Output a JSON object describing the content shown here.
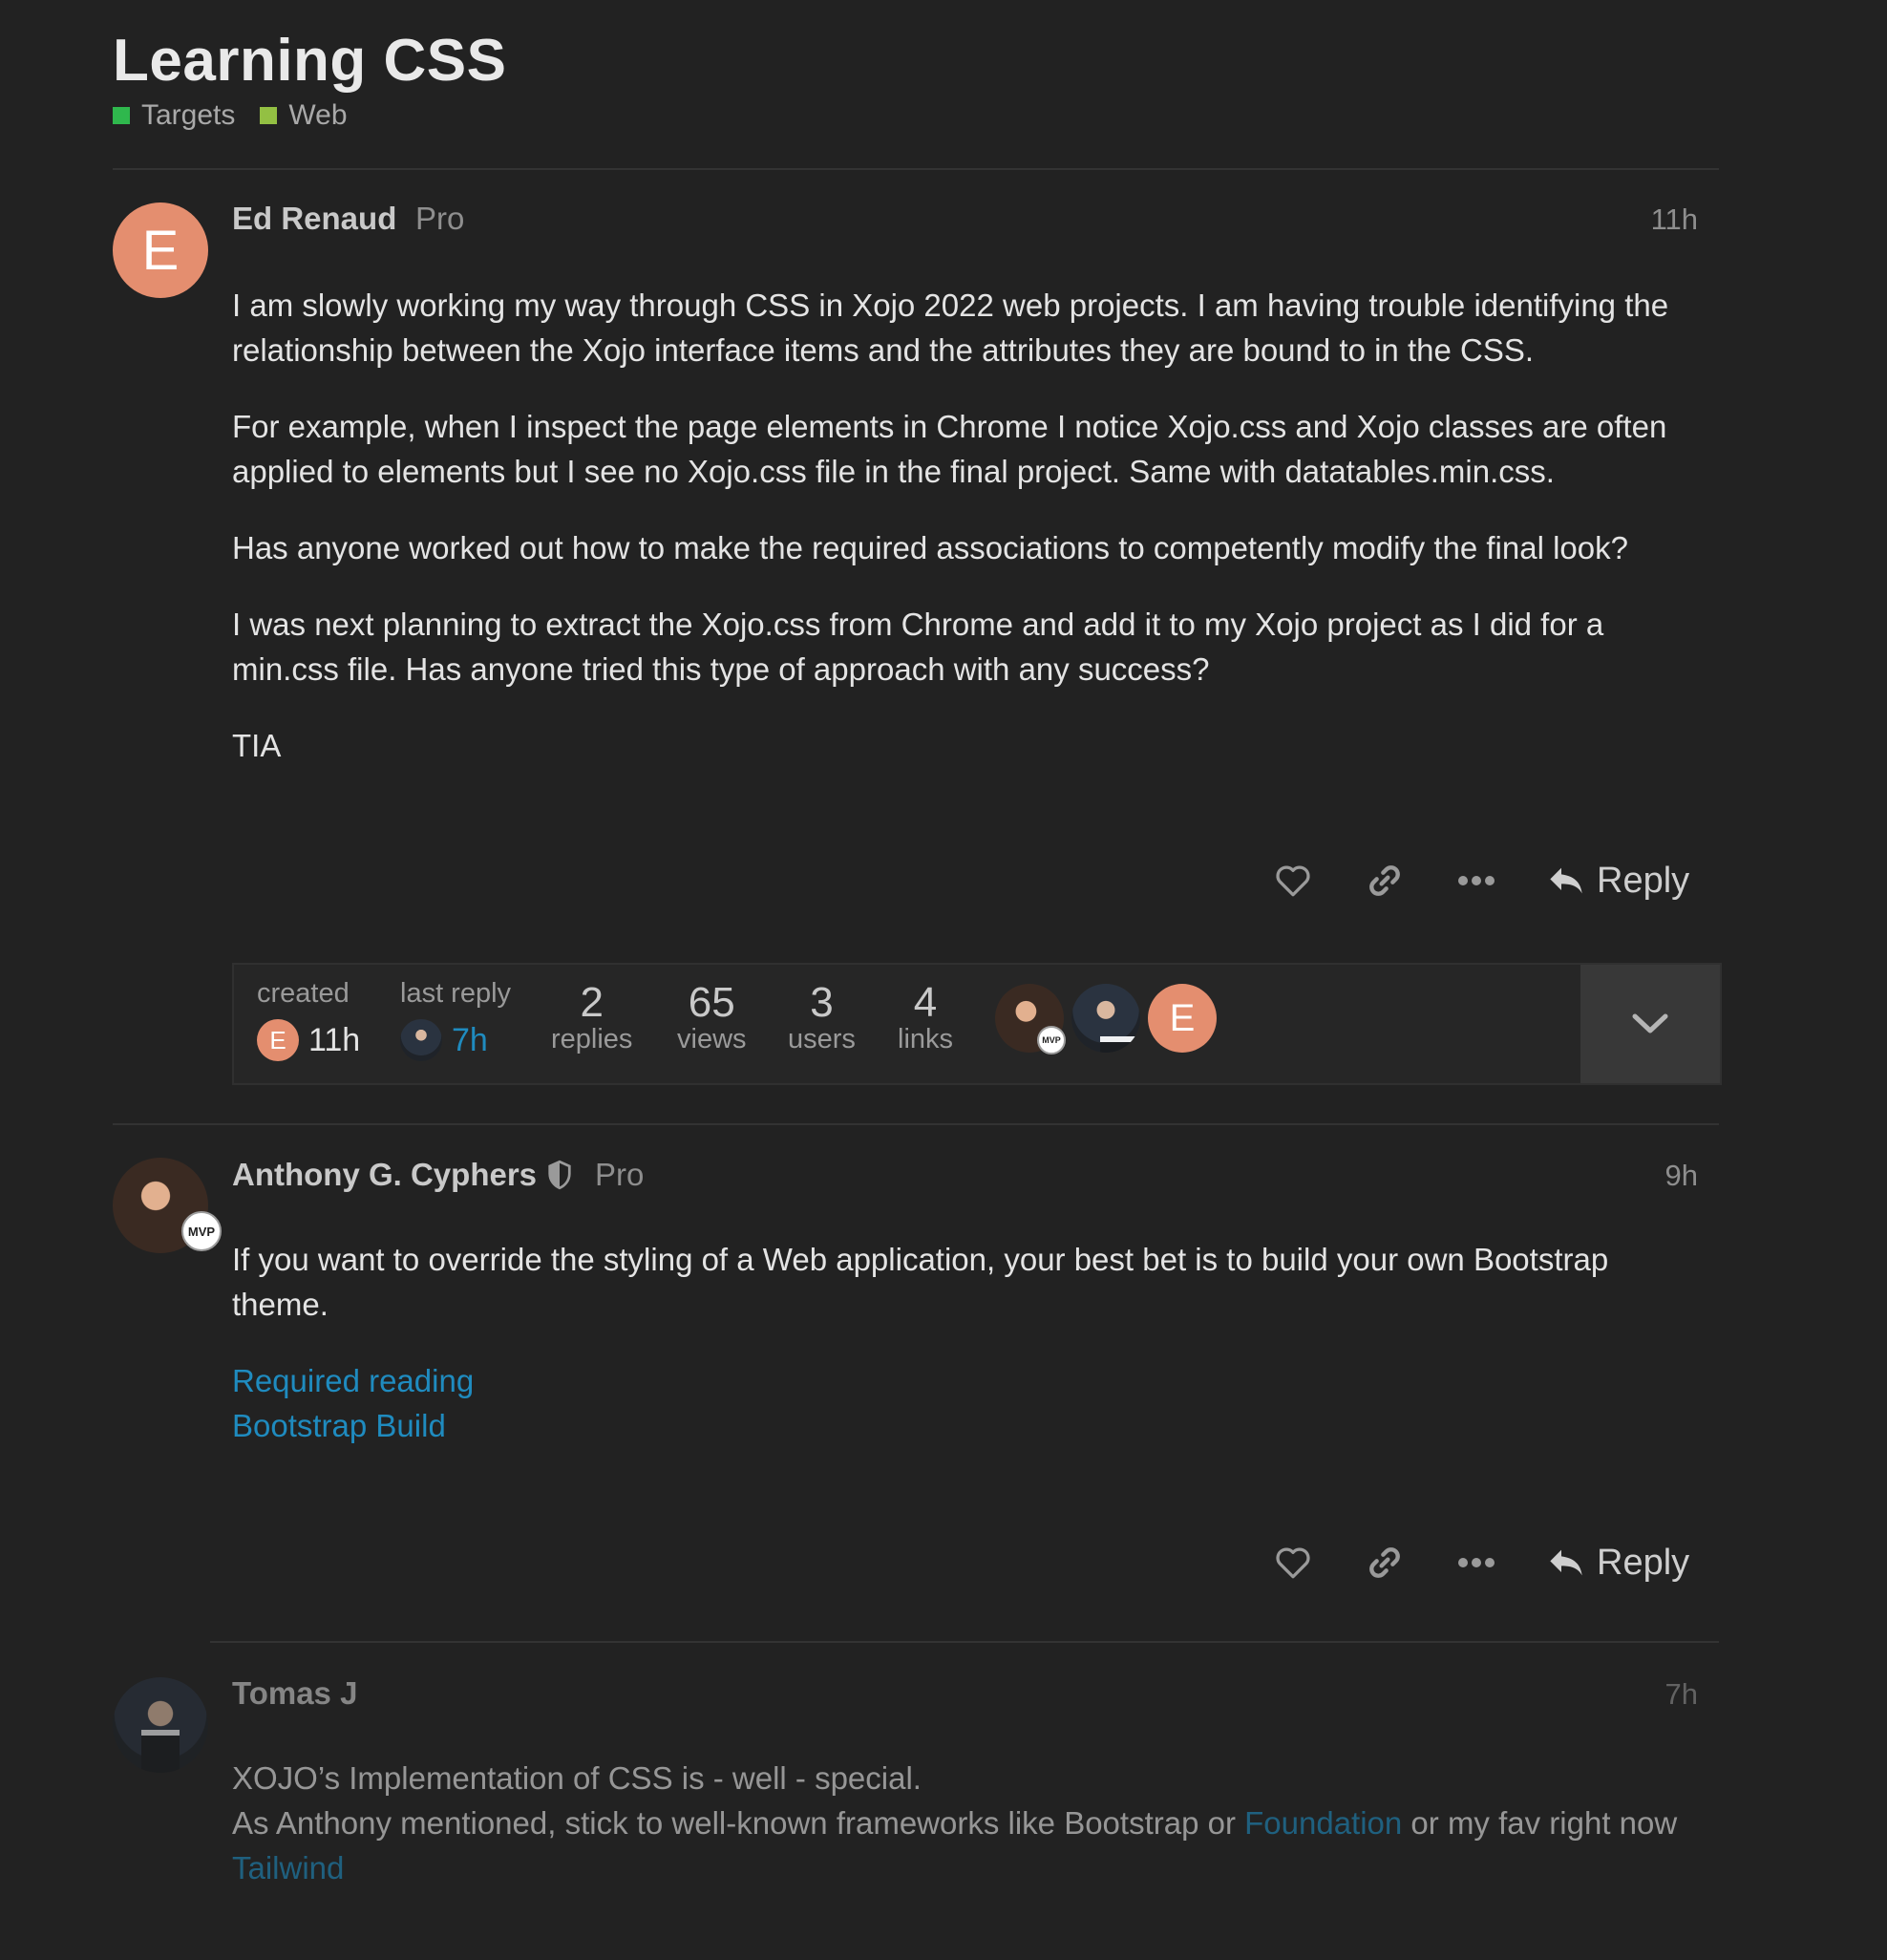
{
  "topic": {
    "title": "Learning CSS",
    "categories": [
      {
        "name": "Targets",
        "color": "#2fb84d"
      },
      {
        "name": "Web",
        "color": "#93c043"
      }
    ]
  },
  "posts": [
    {
      "author": "Ed Renaud",
      "user_title": "Pro",
      "avatar_letter": "E",
      "age": "11h",
      "paragraphs": [
        "I am slowly working my way through CSS in Xojo 2022 web projects. I am having trouble identifying the relationship between the Xojo interface items and the attributes they are bound to in the CSS.",
        "For example, when I inspect the page elements in Chrome I notice Xojo.css and Xojo classes are often applied to elements but I see no Xojo.css file in the final project. Same with datatables.min.css.",
        "Has anyone worked out how to make the required associations to competently modify the final look?",
        "I was next planning to extract the Xojo.css from Chrome and add it to my Xojo project as I did for a min.css file. Has anyone tried this type of approach with any success?",
        "TIA"
      ],
      "reply_label": "Reply"
    },
    {
      "author": "Anthony G. Cyphers",
      "user_title": "Pro",
      "badge": "MVP",
      "age": "9h",
      "paragraph": "If you want to override the styling of a Web application, your best bet is to build your own Bootstrap theme.",
      "links": [
        "Required reading",
        "Bootstrap Build"
      ],
      "reply_label": "Reply"
    },
    {
      "author": "Tomas J",
      "age": "7h",
      "line1": "XOJO’s Implementation of CSS is - well - special.",
      "line2_before": "As Anthony mentioned, stick to well-known frameworks like Bootstrap or ",
      "line2_link": "Foundation",
      "line2_after": " or my fav right now",
      "line3_link": "Tailwind"
    }
  ],
  "topic_map": {
    "created_label": "created",
    "created_age": "11h",
    "created_avatar_letter": "E",
    "last_reply_label": "last reply",
    "last_reply_age": "7h",
    "stats": [
      {
        "num": "2",
        "label": "replies"
      },
      {
        "num": "65",
        "label": "views"
      },
      {
        "num": "3",
        "label": "users"
      },
      {
        "num": "4",
        "label": "links"
      }
    ],
    "participants_mvp": "MVP",
    "participant_letter": "E"
  },
  "colors": {
    "accent_link": "#1f8bbf",
    "avatar_orange": "#e48e6f"
  }
}
